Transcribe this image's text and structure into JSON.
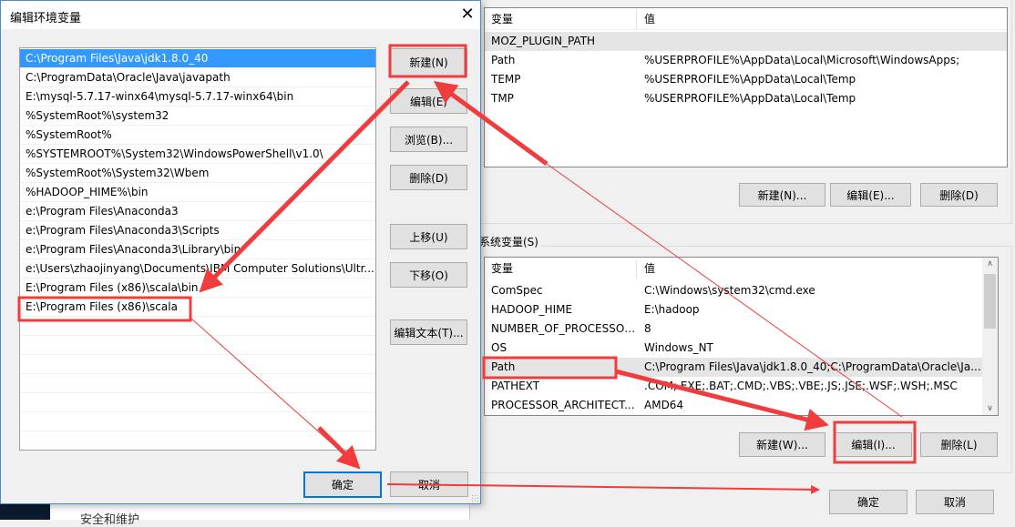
{
  "env_dialog": {
    "user_vars": {
      "headers": [
        "变量",
        "值"
      ],
      "rows": [
        {
          "name": "MOZ_PLUGIN_PATH",
          "value": ""
        },
        {
          "name": "Path",
          "value": "%USERPROFILE%\\AppData\\Local\\Microsoft\\WindowsApps;"
        },
        {
          "name": "TEMP",
          "value": "%USERPROFILE%\\AppData\\Local\\Temp"
        },
        {
          "name": "TMP",
          "value": "%USERPROFILE%\\AppData\\Local\\Temp"
        }
      ],
      "new_label": "新建(N)...",
      "edit_label": "编辑(E)...",
      "delete_label": "删除(D)"
    },
    "system_vars": {
      "group_label": "系统变量(S)",
      "headers": [
        "变量",
        "值"
      ],
      "rows": [
        {
          "name": "ComSpec",
          "value": "C:\\Windows\\system32\\cmd.exe"
        },
        {
          "name": "HADOOP_HIME",
          "value": "E:\\hadoop"
        },
        {
          "name": "NUMBER_OF_PROCESSORS",
          "value": "8"
        },
        {
          "name": "OS",
          "value": "Windows_NT"
        },
        {
          "name": "Path",
          "value": "C:\\Program Files\\Java\\jdk1.8.0_40;C:\\ProgramData\\Oracle\\Ja..."
        },
        {
          "name": "PATHEXT",
          "value": ".COM;.EXE;.BAT;.CMD;.VBS;.VBE;.JS;.JSE;.WSF;.WSH;.MSC"
        },
        {
          "name": "PROCESSOR_ARCHITECT...",
          "value": "AMD64"
        }
      ],
      "new_label": "新建(W)...",
      "edit_label": "编辑(I)...",
      "delete_label": "删除(L)"
    },
    "ok_label": "确定",
    "cancel_label": "取消"
  },
  "edit_dialog": {
    "title": "编辑环境变量",
    "entries": [
      "C:\\Program Files\\Java\\jdk1.8.0_40",
      "C:\\ProgramData\\Oracle\\Java\\javapath",
      "E:\\mysql-5.7.17-winx64\\mysql-5.7.17-winx64\\bin",
      "%SystemRoot%\\system32",
      "%SystemRoot%",
      "%SYSTEMROOT%\\System32\\WindowsPowerShell\\v1.0\\",
      "%SystemRoot%\\System32\\Wbem",
      "%HADOOP_HIME%\\bin",
      "e:\\Program Files\\Anaconda3",
      "e:\\Program Files\\Anaconda3\\Scripts",
      "e:\\Program Files\\Anaconda3\\Library\\bin",
      "e:\\Users\\zhaojinyang\\Documents\\IBM Computer Solutions\\Ultr...",
      "E:\\Program Files (x86)\\scala\\bin",
      "E:\\Program Files (x86)\\scala"
    ],
    "buttons": {
      "new": "新建(N)",
      "edit": "编辑(E)",
      "browse": "浏览(B)...",
      "delete": "删除(D)",
      "up": "上移(U)",
      "down": "下移(O)",
      "edit_text": "编辑文本(T)..."
    },
    "ok_label": "确定",
    "cancel_label": "取消"
  },
  "background_text": "安全和维护",
  "colors": {
    "selection": "#3399ff",
    "annotation": "#f03c3c",
    "focus": "#0078d7"
  }
}
